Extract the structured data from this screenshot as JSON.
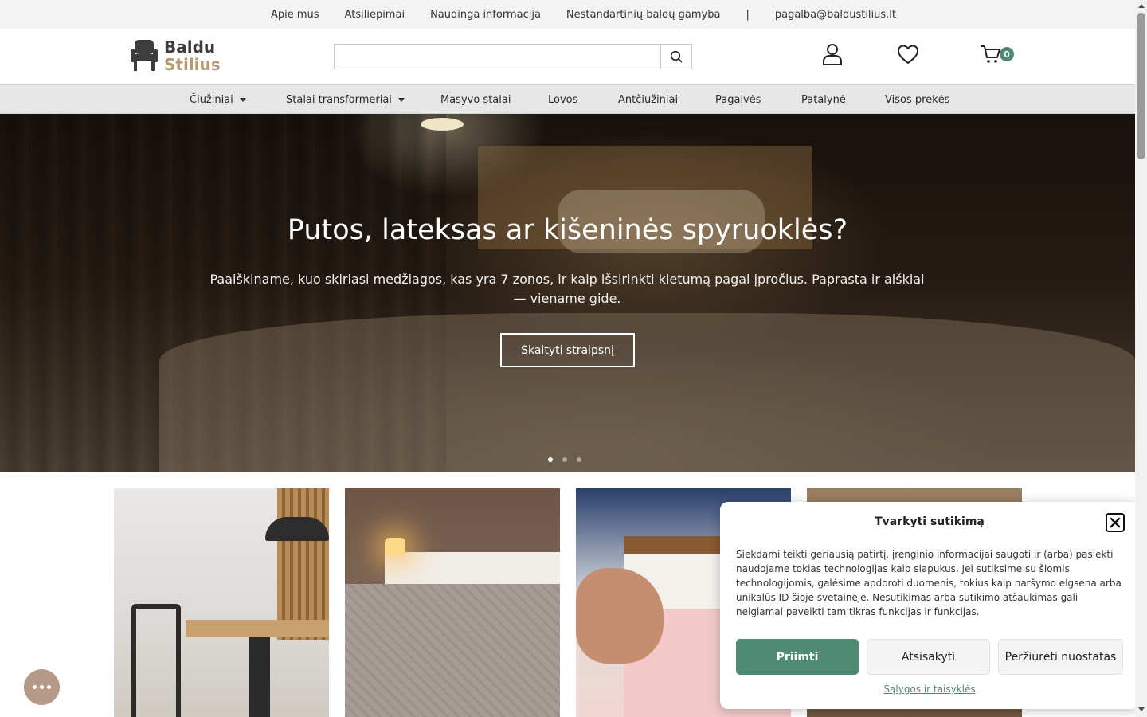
{
  "topbar": {
    "links": [
      "Apie mus",
      "Atsiliepimai",
      "Naudinga informacija",
      "Nestandartinių baldų gamyba"
    ],
    "separator": "|",
    "email": "pagalba@baldustilius.lt"
  },
  "header": {
    "logo_line1": "Baldu",
    "logo_line2": "Stilius",
    "search_placeholder": "",
    "cart_count": "0",
    "icons": [
      "search-icon",
      "user-icon",
      "heart-icon",
      "cart-icon"
    ]
  },
  "nav": {
    "items": [
      {
        "label": "Čiužiniai",
        "dropdown": true
      },
      {
        "label": "Stalai transformeriai",
        "dropdown": true
      },
      {
        "label": "Masyvo stalai",
        "dropdown": false
      },
      {
        "label": "Lovos",
        "dropdown": false
      },
      {
        "label": "Antčiužiniai",
        "dropdown": false
      },
      {
        "label": "Pagalvės",
        "dropdown": false
      },
      {
        "label": "Patalynė",
        "dropdown": false
      },
      {
        "label": "Visos prekės",
        "dropdown": false
      }
    ]
  },
  "hero": {
    "title": "Putos, lateksas ar kišeninės spyruoklės?",
    "subtitle": "Paaiškiname, kuo skiriasi medžiagos, kas yra 7 zonos, ir kaip išsirinkti kietumą pagal įpročius. Paprasta ir aiškiai — viename gide.",
    "button_label": "Skaityti straipsnį",
    "slides": 3,
    "active_slide": 1
  },
  "consent": {
    "title": "Tvarkyti sutikimą",
    "text": "Siekdami teikti geriausią patirtį, įrenginio informacijai saugoti ir (arba) pasiekti naudojame tokias technologijas kaip slapukus. Jei sutiksime su šiomis technologijomis, galėsime apdoroti duomenis, tokius kaip naršymo elgsena arba unikalūs ID šioje svetainėje. Nesutikimas arba sutikimo atšaukimas gali neigiamai paveikti tam tikras funkcijas ir funkcijas.",
    "accept_label": "Priimti",
    "deny_label": "Atsisakyti",
    "view_label": "Peržiūrėti nuostatas",
    "link_label": "Sąlygos ir taisyklės"
  },
  "colors": {
    "accent": "#4f8a73",
    "logo_gold": "#b59a6e",
    "nav_bg": "#e7e7e7",
    "chat_bg": "#b59a8a"
  }
}
